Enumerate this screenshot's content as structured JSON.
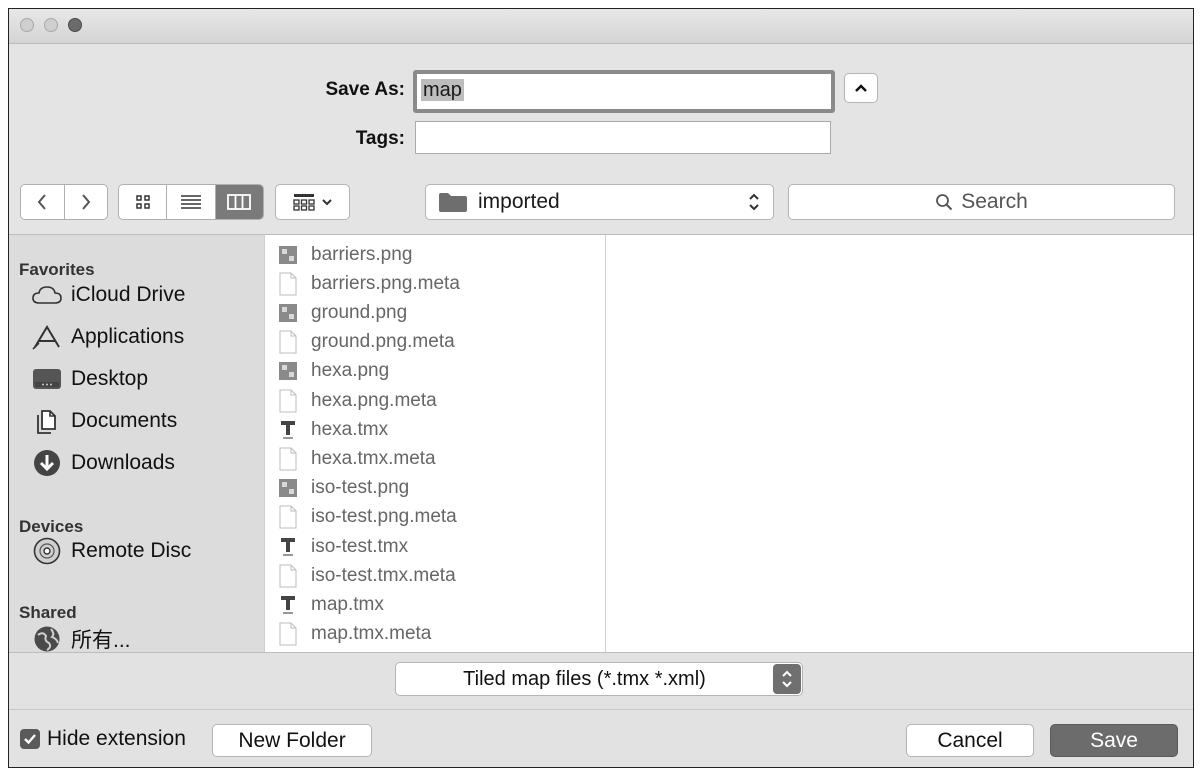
{
  "dialog": {
    "save_as_label": "Save As:",
    "save_as_value": "map",
    "tags_label": "Tags:",
    "tags_value": ""
  },
  "toolbar": {
    "location": "imported",
    "search_placeholder": "Search",
    "active_view": "columns"
  },
  "sidebar": {
    "favorites_header": "Favorites",
    "favorites": [
      {
        "label": "iCloud Drive",
        "icon": "cloud-icon"
      },
      {
        "label": "Applications",
        "icon": "applications-icon"
      },
      {
        "label": "Desktop",
        "icon": "desktop-icon"
      },
      {
        "label": "Documents",
        "icon": "documents-icon"
      },
      {
        "label": "Downloads",
        "icon": "downloads-icon"
      }
    ],
    "devices_header": "Devices",
    "devices": [
      {
        "label": "Remote Disc",
        "icon": "disc-icon"
      }
    ],
    "shared_header": "Shared",
    "shared": [
      {
        "label": "所有...",
        "icon": "network-globe-icon"
      }
    ]
  },
  "files": [
    {
      "name": "barriers.png",
      "icon": "png-image-icon"
    },
    {
      "name": "barriers.png.meta",
      "icon": "document-icon"
    },
    {
      "name": "ground.png",
      "icon": "png-image-icon"
    },
    {
      "name": "ground.png.meta",
      "icon": "document-icon"
    },
    {
      "name": "hexa.png",
      "icon": "png-image-icon"
    },
    {
      "name": "hexa.png.meta",
      "icon": "document-icon"
    },
    {
      "name": "hexa.tmx",
      "icon": "tmx-icon"
    },
    {
      "name": "hexa.tmx.meta",
      "icon": "document-icon"
    },
    {
      "name": "iso-test.png",
      "icon": "png-image-icon"
    },
    {
      "name": "iso-test.png.meta",
      "icon": "document-icon"
    },
    {
      "name": "iso-test.tmx",
      "icon": "tmx-icon"
    },
    {
      "name": "iso-test.tmx.meta",
      "icon": "document-icon"
    },
    {
      "name": "map.tmx",
      "icon": "tmx-icon"
    },
    {
      "name": "map.tmx.meta",
      "icon": "document-icon"
    }
  ],
  "format": {
    "selected": "Tiled map files (*.tmx *.xml)"
  },
  "footer": {
    "hide_extension_label": "Hide extension",
    "hide_extension_checked": true,
    "new_folder_label": "New Folder",
    "cancel_label": "Cancel",
    "save_label": "Save"
  }
}
